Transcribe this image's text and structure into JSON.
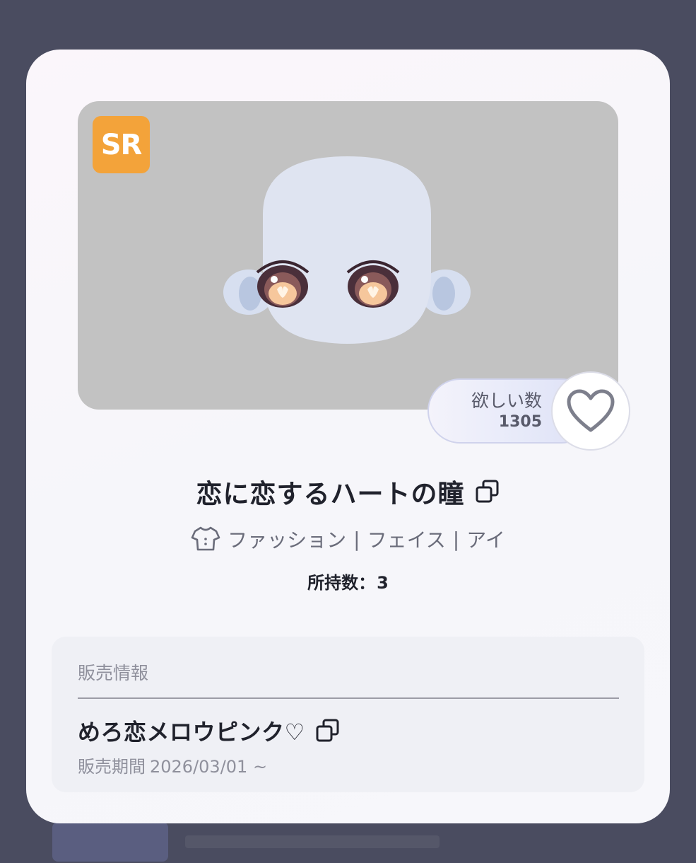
{
  "item": {
    "rarity": "SR",
    "want_label": "欲しい数",
    "want_count": "1305",
    "title": "恋に恋するハートの瞳",
    "categories": [
      "ファッション",
      "フェイス",
      "アイ"
    ],
    "category_separator": "|",
    "owned_label": "所持数：",
    "owned_count": "3"
  },
  "sale": {
    "heading": "販売情報",
    "item_name": "めろ恋メロウピンク♡",
    "period_label": "販売期間",
    "period_value": "2026/03/01 ~"
  },
  "colors": {
    "badge": "#f3a33a",
    "preview_bg": "#c2c2c2",
    "backdrop": "#4a4c60"
  },
  "icons": {
    "want": "heart-outline-icon",
    "copy": "copy-icon",
    "category": "shirt-icon"
  }
}
